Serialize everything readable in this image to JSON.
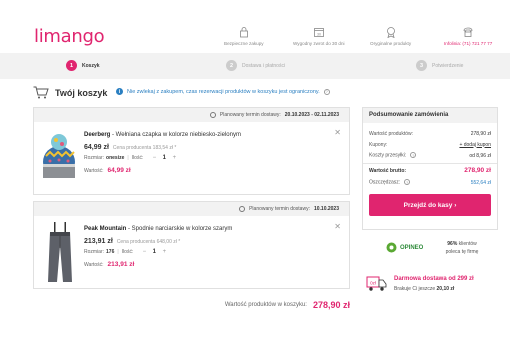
{
  "brand": {
    "logo": "limango",
    "accent": "#e0256f"
  },
  "header": {
    "features": [
      {
        "icon": "lock-icon",
        "label": "Bezpieczne zakupy"
      },
      {
        "icon": "calendar-return-icon",
        "label": "Wygodny zwrot do 30 dni"
      },
      {
        "icon": "badge-icon",
        "label": "Oryginalne produkty"
      },
      {
        "icon": "phone-icon",
        "label": "Infolinia: (71) 721 77 77"
      }
    ]
  },
  "steps": [
    {
      "num": "1",
      "label": "Koszyk"
    },
    {
      "num": "2",
      "label": "Dostawa i płatności"
    },
    {
      "num": "3",
      "label": "Potwierdzenie"
    }
  ],
  "cart": {
    "title": "Twój koszyk",
    "info": "Nie zwlekaj z zakupem, czas rezerwacji produktów w koszyku jest ograniczony."
  },
  "items": [
    {
      "delivery_label": "Planowany termin dostawy:",
      "delivery_date": "20.10.2023 - 02.11.2023",
      "brand": "Deerberg",
      "name": " - Wełniana czapka w kolorze niebiesko-zielonym",
      "price": "64,99 zł",
      "producer_price": "Cena producenta 183,54 zł *",
      "size_label": "Rozmiar:",
      "size": "onesize",
      "qty_label": "Ilość:",
      "qty": "1",
      "value_label": "Wartość:",
      "value": "64,99 zł"
    },
    {
      "delivery_label": "Planowany termin dostawy:",
      "delivery_date": "10.10.2023",
      "brand": "Peak Mountain",
      "name": " - Spodnie narciarskie w kolorze szarym",
      "price": "213,91 zł",
      "producer_price": "Cena producenta 648,00 zł *",
      "size_label": "Rozmiar:",
      "size": "176",
      "qty_label": "Ilość:",
      "qty": "1",
      "value_label": "Wartość:",
      "value": "213,91 zł"
    }
  ],
  "cart_total": {
    "label": "Wartość produktów w koszyku:",
    "value": "278,90 zł"
  },
  "summary": {
    "title": "Podsumowanie zamówienia",
    "products_label": "Wartość produktów:",
    "products_value": "278,90 zł",
    "coupons_label": "Kupony:",
    "coupons_link": "+ dodaj kupon",
    "shipping_label": "Koszty przesyłki:",
    "shipping_value": "od 8,96 zł",
    "gross_label": "Wartość brutto:",
    "gross_value": "278,90 zł",
    "savings_label": "Oszczędzasz:",
    "savings_value": "552,64 zł",
    "pay_button": "Przejdź do kasy ›"
  },
  "opineo": {
    "brand": "OPINEO",
    "percent": "96%",
    "line1": " klientów",
    "line2": "poleca tę firmę"
  },
  "delivery": {
    "title": "Darmowa dostawa od 299 zł",
    "missing_label": "Brakuje Ci jeszcze",
    "missing_value": "20,10 zł"
  }
}
